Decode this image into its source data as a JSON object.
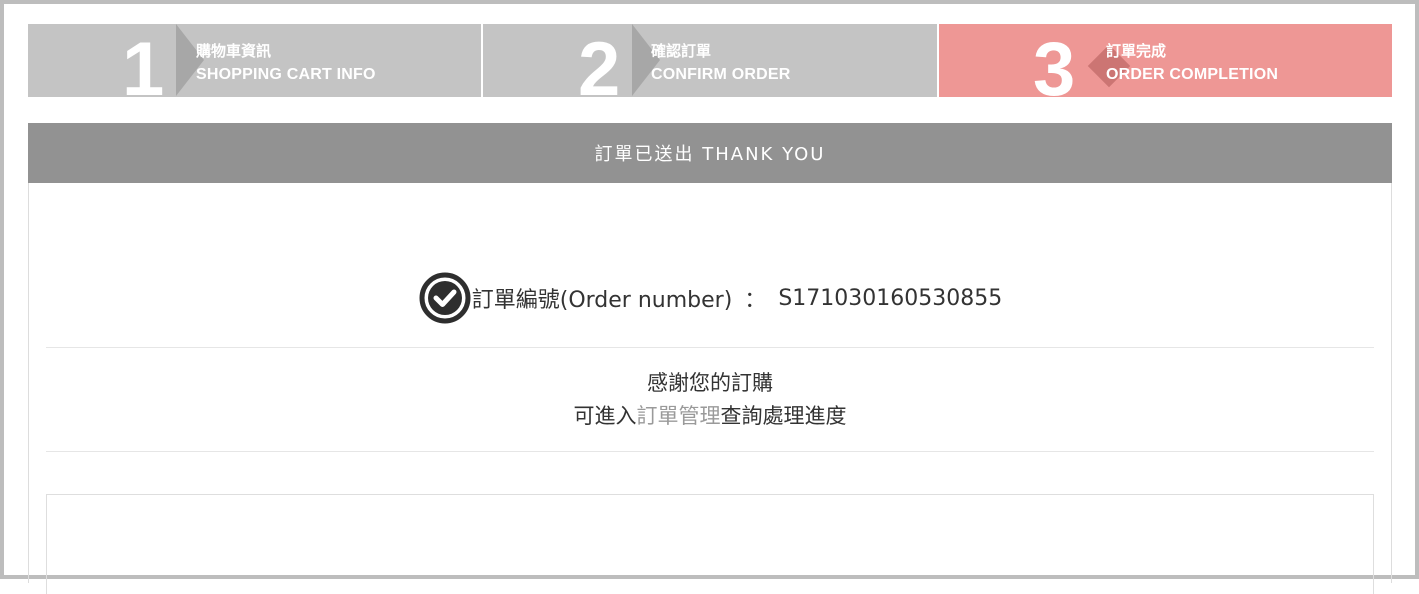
{
  "steps": [
    {
      "num": "1",
      "zh": "購物車資訊",
      "en": "SHOPPING CART INFO"
    },
    {
      "num": "2",
      "zh": "確認訂單",
      "en": "CONFIRM ORDER"
    },
    {
      "num": "3",
      "zh": "訂單完成",
      "en": "ORDER COMPLETION"
    }
  ],
  "panel": {
    "header": "訂單已送出 THANK YOU",
    "order_label": "訂單編號(Order number)",
    "order_sep": "：",
    "order_number": "S171030160530855",
    "thanks_line1": "感謝您的訂購",
    "thanks_line2_prefix": "可進入",
    "thanks_link": "訂單管理",
    "thanks_line2_suffix": "查詢處理進度"
  },
  "colors": {
    "step_inactive": "#c4c4c4",
    "step_active": "#ee9795",
    "header_bg": "#929292",
    "link": "#9a9a9a"
  },
  "icons": {
    "order_status": "check-circle-icon"
  }
}
